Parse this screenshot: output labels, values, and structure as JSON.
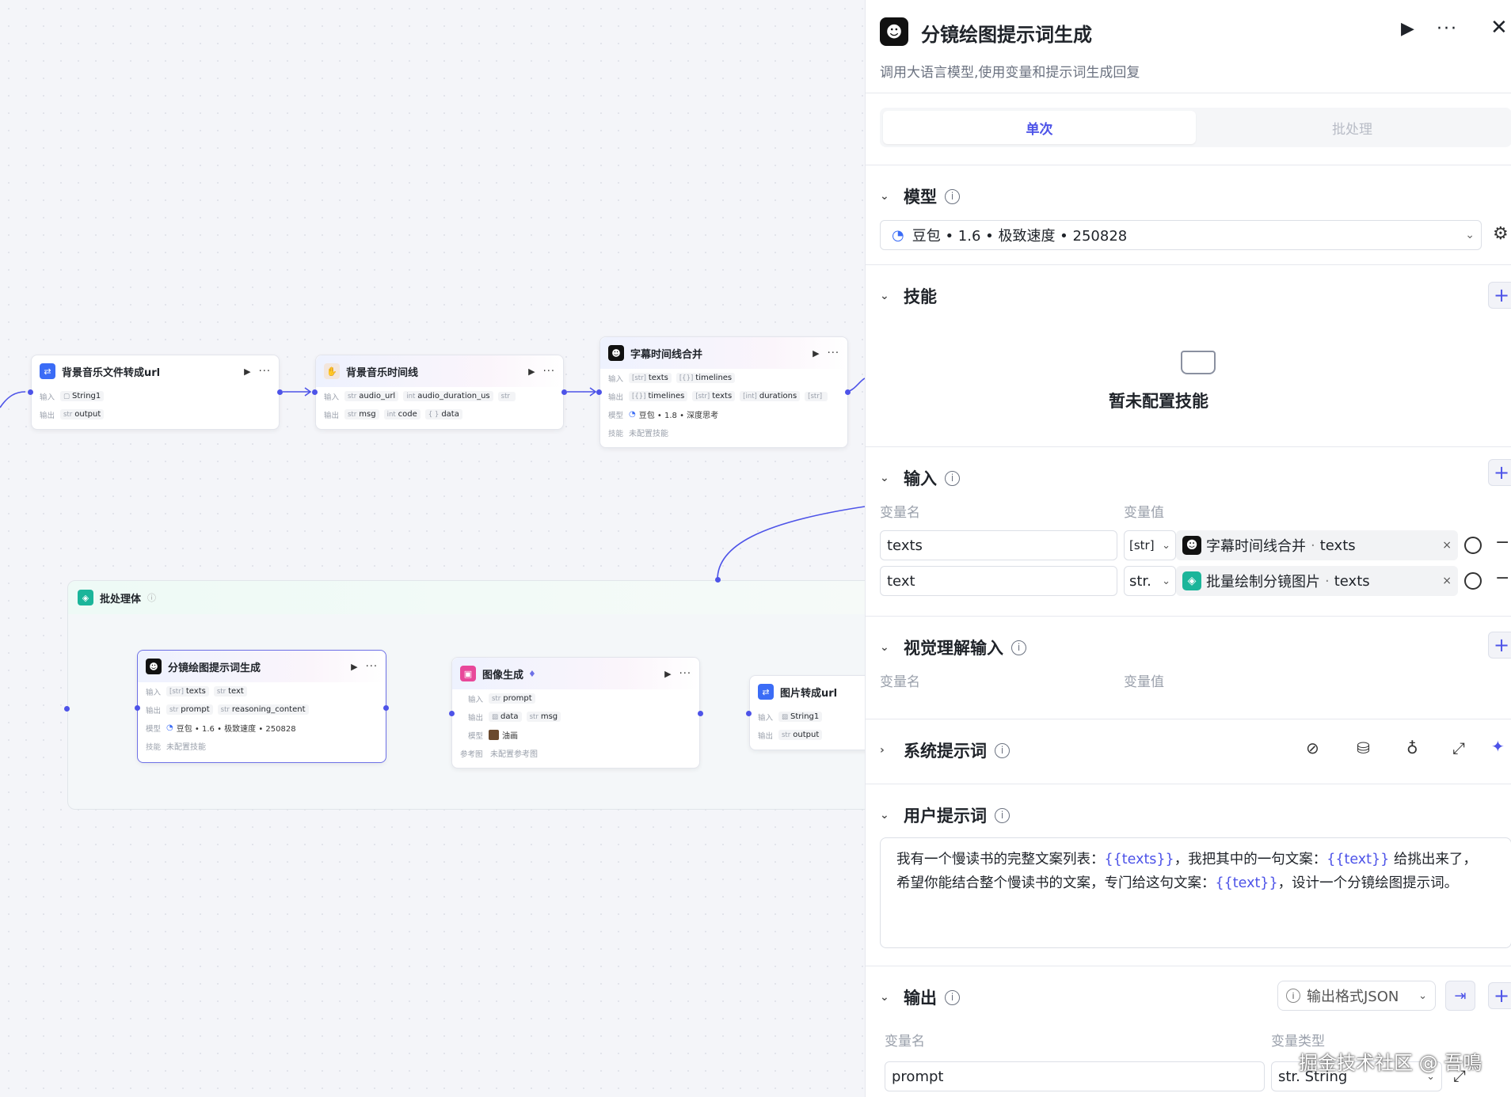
{
  "nodes": {
    "bgm_url": {
      "title": "背景音乐文件转成url",
      "in_label": "输入",
      "out_label": "输出",
      "in_chip": "String1",
      "out_chip": "output",
      "out_type": "str"
    },
    "bgm_timeline": {
      "title": "背景音乐时间线",
      "in_label": "输入",
      "out_label": "输出",
      "in1": "audio_url",
      "in1_t": "str",
      "in2": "audio_duration_us",
      "in2_t": "int",
      "in3_t": "str",
      "out1": "msg",
      "out1_t": "str",
      "out2": "code",
      "out2_t": "int",
      "out3": "data",
      "out3_t": "{ }"
    },
    "subtitle_merge": {
      "title": "字幕时间线合并",
      "in_label": "输入",
      "out_label": "输出",
      "model_label": "模型",
      "skill_label": "技能",
      "in1": "texts",
      "in1_t": "[str]",
      "in2": "timelines",
      "in2_t": "[{}]",
      "out1": "timelines",
      "out1_t": "[{}]",
      "out2": "texts",
      "out2_t": "[str]",
      "out3": "durations",
      "out3_t": "[int]",
      "out4_t": "[str]",
      "model": "豆包 • 1.8 • 深度思考",
      "skill": "未配置技能"
    },
    "batch": {
      "title": "批处理体"
    },
    "storyboard": {
      "title": "分镜绘图提示词生成",
      "in_label": "输入",
      "out_label": "输出",
      "model_label": "模型",
      "skill_label": "技能",
      "in1": "texts",
      "in1_t": "[str]",
      "in2": "text",
      "in2_t": "str",
      "out1": "prompt",
      "out1_t": "str",
      "out2": "reasoning_content",
      "out2_t": "str",
      "model": "豆包 • 1.6 • 极致速度 • 250828",
      "skill": "未配置技能"
    },
    "imagegen": {
      "title": "图像生成",
      "in_label": "输入",
      "out_label": "输出",
      "model_label": "模型",
      "ref_label": "参考图",
      "in1": "prompt",
      "in1_t": "str",
      "out1": "data",
      "out2": "msg",
      "out2_t": "str",
      "model": "油画",
      "ref": "未配置参考图"
    },
    "img2url": {
      "title": "图片转成url",
      "in_label": "输入",
      "out_label": "输出",
      "in1": "String1",
      "out1": "output",
      "out1_t": "str"
    }
  },
  "panel": {
    "title": "分镜绘图提示词生成",
    "description": "调用大语言模型,使用变量和提示词生成回复",
    "tabs": [
      "单次",
      "批处理"
    ],
    "model": {
      "heading": "模型",
      "value": "豆包 • 1.6 • 极致速度 • 250828"
    },
    "skills": {
      "heading": "技能",
      "empty": "暂未配置技能"
    },
    "inputs": {
      "heading": "输入",
      "col_name": "变量名",
      "col_value": "变量值",
      "rows": [
        {
          "name": "texts",
          "type": "[str]",
          "source": "字幕时间线合并",
          "field": "texts"
        },
        {
          "name": "text",
          "type": "str.",
          "source": "批量绘制分镜图片",
          "field": "texts"
        }
      ]
    },
    "vision": {
      "heading": "视觉理解输入",
      "col_name": "变量名",
      "col_value": "变量值"
    },
    "system_prompt": {
      "heading": "系统提示词"
    },
    "user_prompt": {
      "heading": "用户提示词",
      "p1": "我有一个慢读书的完整文案列表：",
      "v1": "{{texts}}",
      "p2": "，我把其中的一句文案：",
      "v2": "{{text}}",
      "p3": " 给挑出来了，",
      "p4": "希望你能结合整个慢读书的文案，专门给这句文案：",
      "v3": "{{text}}",
      "p5": "，设计一个分镜绘图提示词。"
    },
    "output": {
      "heading": "输出",
      "format_label": "输出格式JSON",
      "col_name": "变量名",
      "col_type": "变量类型",
      "rows": [
        {
          "name": "prompt",
          "type": "str. String"
        }
      ]
    }
  },
  "watermark": "掘金技术社区 @ 吾鳴",
  "colors": {
    "accent": "#4d53e8",
    "batch": "#1bb59a",
    "plugin": "#3b6cf6"
  }
}
